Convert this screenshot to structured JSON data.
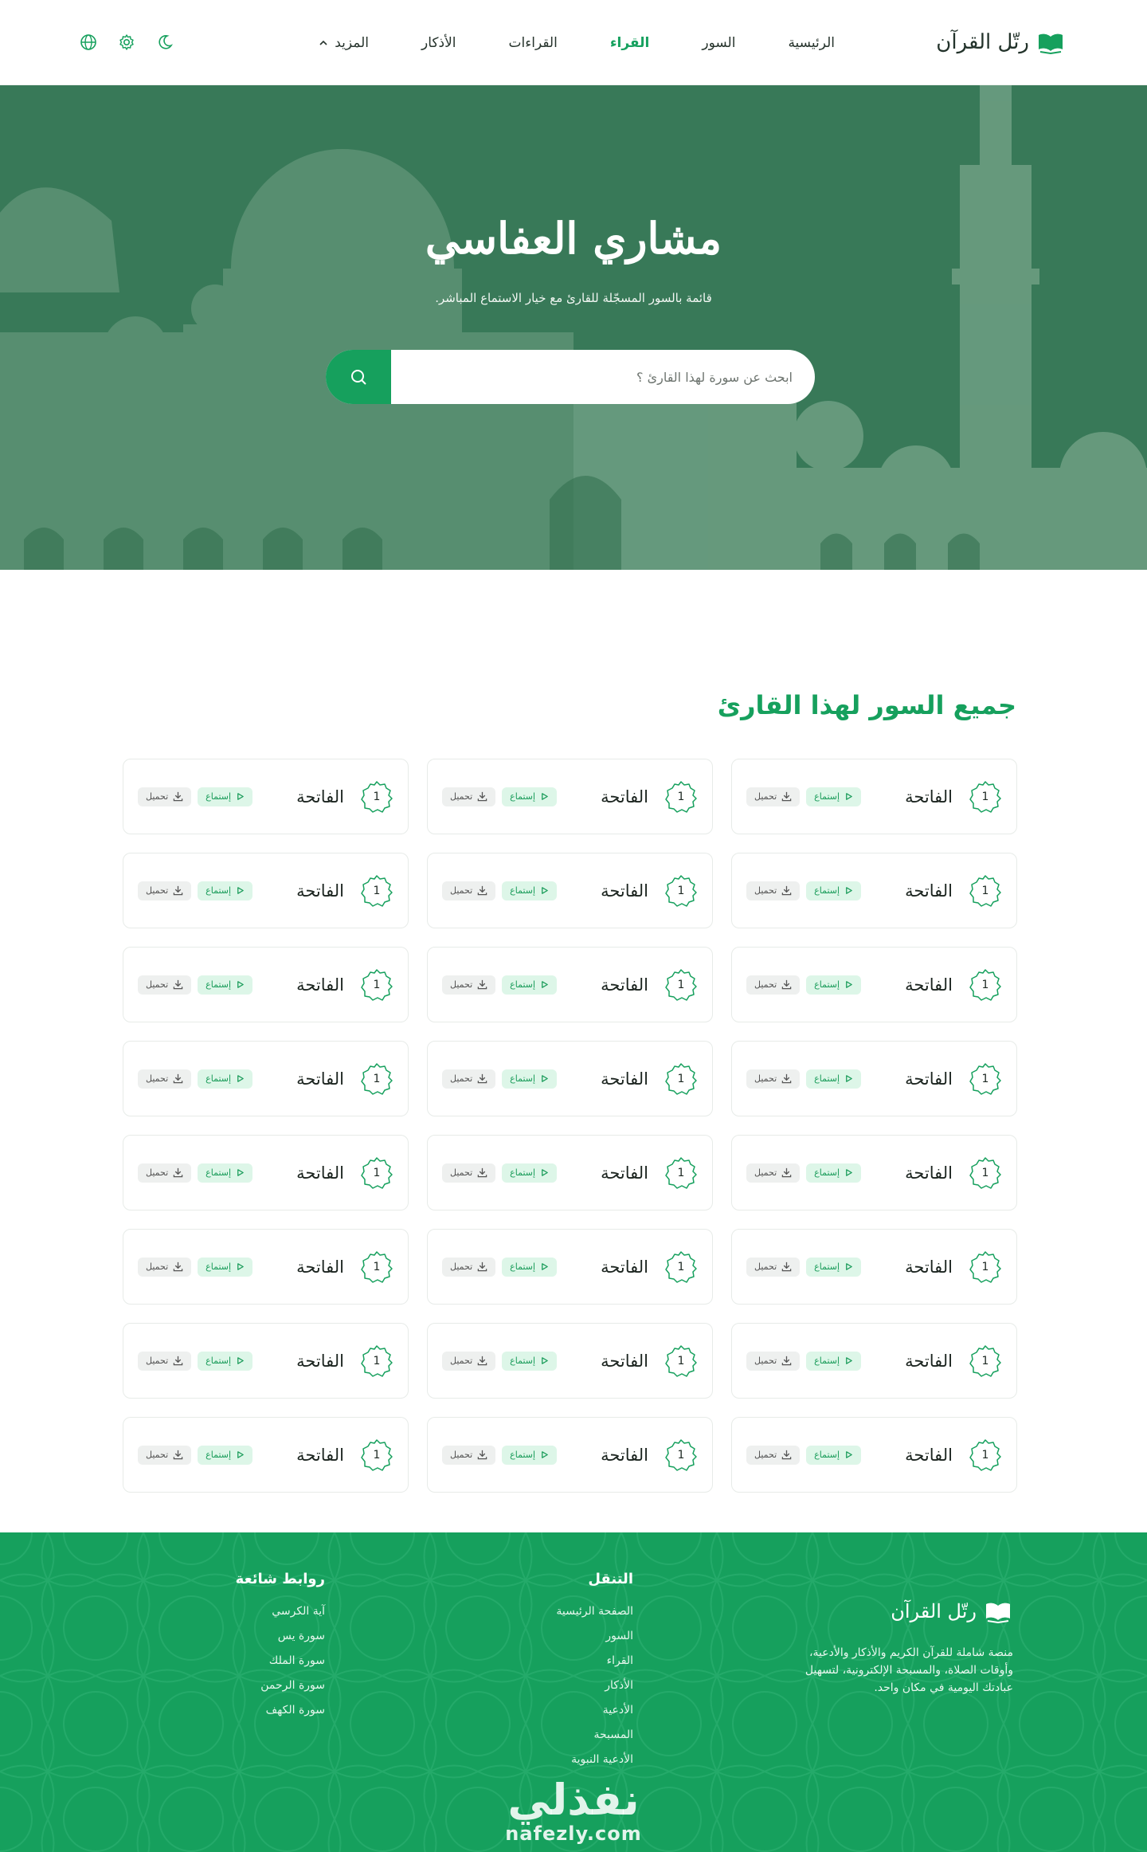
{
  "header": {
    "logo_text": "رتّل القرآن",
    "nav": [
      {
        "label": "الرئيسية",
        "active": false
      },
      {
        "label": "السور",
        "active": false
      },
      {
        "label": "القراء",
        "active": true
      },
      {
        "label": "القراءات",
        "active": false
      },
      {
        "label": "الأذكار",
        "active": false
      },
      {
        "label": "المزيد",
        "active": false
      }
    ],
    "icons": [
      "moon-icon",
      "settings-icon",
      "globe-icon"
    ]
  },
  "hero": {
    "title": "مشاري العفاسي",
    "subtitle": "قائمة بالسور المسجّلة للقارئ مع خيار الاستماع المباشر.",
    "search_placeholder": "ابحث عن سورة لهذا القارئ ؟"
  },
  "section": {
    "title": "جميع السور لهذا القارئ",
    "listen_label": "إستماع",
    "download_label": "تحميل",
    "surahs": [
      {
        "number": "1",
        "name": "الفاتحة"
      },
      {
        "number": "1",
        "name": "الفاتحة"
      },
      {
        "number": "1",
        "name": "الفاتحة"
      },
      {
        "number": "1",
        "name": "الفاتحة"
      },
      {
        "number": "1",
        "name": "الفاتحة"
      },
      {
        "number": "1",
        "name": "الفاتحة"
      },
      {
        "number": "1",
        "name": "الفاتحة"
      },
      {
        "number": "1",
        "name": "الفاتحة"
      },
      {
        "number": "1",
        "name": "الفاتحة"
      },
      {
        "number": "1",
        "name": "الفاتحة"
      },
      {
        "number": "1",
        "name": "الفاتحة"
      },
      {
        "number": "1",
        "name": "الفاتحة"
      },
      {
        "number": "1",
        "name": "الفاتحة"
      },
      {
        "number": "1",
        "name": "الفاتحة"
      },
      {
        "number": "1",
        "name": "الفاتحة"
      },
      {
        "number": "1",
        "name": "الفاتحة"
      },
      {
        "number": "1",
        "name": "الفاتحة"
      },
      {
        "number": "1",
        "name": "الفاتحة"
      },
      {
        "number": "1",
        "name": "الفاتحة"
      },
      {
        "number": "1",
        "name": "الفاتحة"
      },
      {
        "number": "1",
        "name": "الفاتحة"
      },
      {
        "number": "1",
        "name": "الفاتحة"
      },
      {
        "number": "1",
        "name": "الفاتحة"
      },
      {
        "number": "1",
        "name": "الفاتحة"
      }
    ]
  },
  "footer": {
    "logo_text": "رتّل القرآن",
    "description": "منصة شاملة للقرآن الكريم والأذكار والأدعية، وأوقات الصلاة، والمسبحة الإلكترونية، لتسهيل عبادتك اليومية في مكان واحد.",
    "nav_title": "التنقل",
    "nav_links": [
      "الصفحة الرئيسية",
      "السور",
      "القراء",
      "الأذكار",
      "الأدعية",
      "المسبحة",
      "الأدعية النبوية"
    ],
    "links_title": "روابط شائعة",
    "popular_links": [
      "آية الكرسي",
      "سورة يس",
      "سورة الملك",
      "سورة الرحمن",
      "سورة الكهف"
    ],
    "watermark_ar": "نفذلي",
    "watermark_en": "nafezly.com"
  },
  "colors": {
    "brand": "#16a05d",
    "listen_bg": "#ddf6e8",
    "download_bg": "#eef0ef"
  }
}
